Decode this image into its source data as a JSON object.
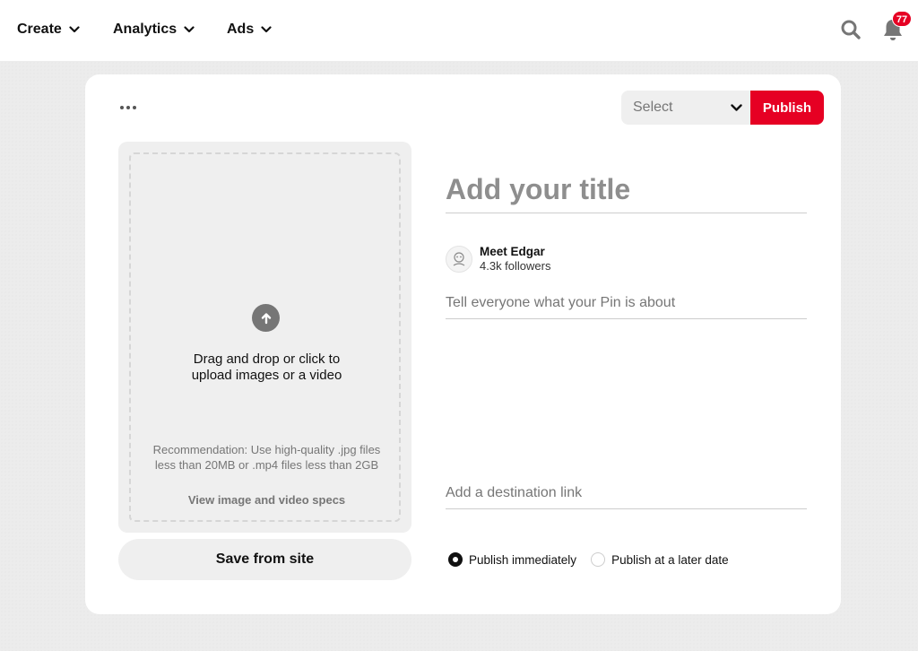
{
  "nav": {
    "items": [
      {
        "label": "Create",
        "icon": "chevron-down-icon"
      },
      {
        "label": "Analytics",
        "icon": "chevron-down-icon"
      },
      {
        "label": "Ads",
        "icon": "chevron-down-icon"
      }
    ],
    "search_icon": "search-icon",
    "notifications_icon": "bell-icon",
    "notification_count": "77"
  },
  "toolbar": {
    "more_icon": "more-options-icon",
    "select_value": "Select",
    "publish_label": "Publish"
  },
  "upload": {
    "icon": "upload-arrow-icon",
    "line1": "Drag and drop or click to",
    "line2": "upload images or a video",
    "recommendation": "Recommendation: Use high-quality .jpg files less than 20MB or .mp4 files less than 2GB",
    "specs_link": "View image and video specs"
  },
  "save_from_site_label": "Save from site",
  "form": {
    "title_placeholder": "Add your title",
    "profile_name": "Meet Edgar",
    "profile_followers": "4.3k followers",
    "description_placeholder": "Tell everyone what your Pin is about",
    "link_placeholder": "Add a destination link"
  },
  "publish_options": [
    {
      "label": "Publish immediately",
      "selected": true
    },
    {
      "label": "Publish at a later date",
      "selected": false
    }
  ],
  "colors": {
    "brand_red": "#e60023",
    "panel_gray": "#efefef"
  }
}
